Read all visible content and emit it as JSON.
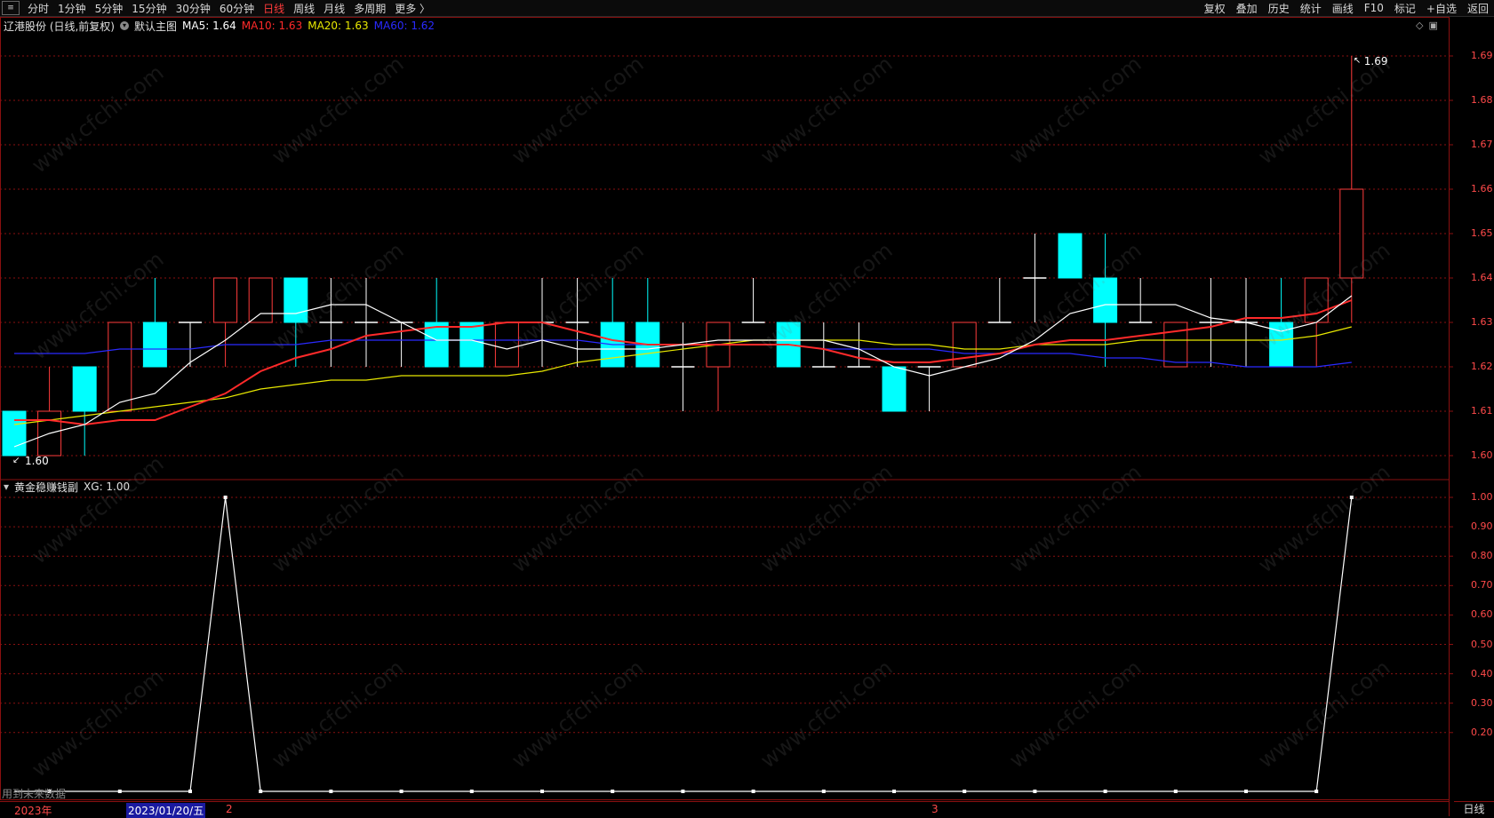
{
  "toolbar": {
    "menu_icon": "menu-icon",
    "periods": [
      {
        "label": "分时",
        "active": false
      },
      {
        "label": "1分钟",
        "active": false
      },
      {
        "label": "5分钟",
        "active": false
      },
      {
        "label": "15分钟",
        "active": false
      },
      {
        "label": "30分钟",
        "active": false
      },
      {
        "label": "60分钟",
        "active": false
      },
      {
        "label": "日线",
        "active": true
      },
      {
        "label": "周线",
        "active": false
      },
      {
        "label": "月线",
        "active": false
      },
      {
        "label": "多周期",
        "active": false
      },
      {
        "label": "更多 〉",
        "active": false
      }
    ],
    "right": [
      "复权",
      "叠加",
      "历史",
      "统计",
      "画线",
      "F10",
      "标记",
      "+自选",
      "返回"
    ]
  },
  "main_legend": {
    "title": "辽港股份 (日线,前复权)",
    "template": "默认主图",
    "ma5": "MA5: 1.64",
    "ma10": "MA10: 1.63",
    "ma20": "MA20: 1.63",
    "ma60": "MA60: 1.62"
  },
  "sub_legend": {
    "title": "黄金稳赚钱副",
    "value": "XG: 1.00"
  },
  "colors": {
    "up": "#ff3b3b",
    "down": "#00ffff",
    "ma5": "#ffffff",
    "ma10": "#ff2a2a",
    "ma20": "#e8e800",
    "ma60": "#2a2aff",
    "grid": "#8a1010",
    "axis": "#ff4a4a"
  },
  "annotations": {
    "max_label": "1.69",
    "min_label": "1.60"
  },
  "main_axis_labels": [
    "1.69",
    "1.68",
    "1.67",
    "1.66",
    "1.65",
    "1.64",
    "1.63",
    "1.62",
    "1.61",
    "1.60"
  ],
  "sub_axis_labels": [
    "1.00",
    "0.90",
    "0.80",
    "0.70",
    "0.60",
    "0.50",
    "0.40",
    "0.30",
    "0.20"
  ],
  "date_axis": {
    "year": "2023年",
    "cursor_date": "2023/01/20/五",
    "month2": "2",
    "month3": "3"
  },
  "period_tab": "日线",
  "footer_note": "用到未来数据",
  "watermark": "www.cfchi.com",
  "chart_data": {
    "type": "candlestick",
    "ylim": [
      1.595,
      1.695
    ],
    "candles": [
      {
        "o": 1.61,
        "h": 1.61,
        "l": 1.6,
        "c": 1.6
      },
      {
        "o": 1.6,
        "h": 1.62,
        "l": 1.6,
        "c": 1.61
      },
      {
        "o": 1.62,
        "h": 1.62,
        "l": 1.6,
        "c": 1.61
      },
      {
        "o": 1.61,
        "h": 1.63,
        "l": 1.61,
        "c": 1.63
      },
      {
        "o": 1.63,
        "h": 1.64,
        "l": 1.62,
        "c": 1.62
      },
      {
        "o": 1.63,
        "h": 1.63,
        "l": 1.62,
        "c": 1.63
      },
      {
        "o": 1.63,
        "h": 1.64,
        "l": 1.62,
        "c": 1.64
      },
      {
        "o": 1.63,
        "h": 1.64,
        "l": 1.63,
        "c": 1.64
      },
      {
        "o": 1.64,
        "h": 1.64,
        "l": 1.62,
        "c": 1.63
      },
      {
        "o": 1.63,
        "h": 1.64,
        "l": 1.62,
        "c": 1.63
      },
      {
        "o": 1.63,
        "h": 1.64,
        "l": 1.62,
        "c": 1.63
      },
      {
        "o": 1.63,
        "h": 1.63,
        "l": 1.62,
        "c": 1.63
      },
      {
        "o": 1.63,
        "h": 1.64,
        "l": 1.62,
        "c": 1.62
      },
      {
        "o": 1.63,
        "h": 1.63,
        "l": 1.62,
        "c": 1.62
      },
      {
        "o": 1.62,
        "h": 1.63,
        "l": 1.62,
        "c": 1.63
      },
      {
        "o": 1.63,
        "h": 1.64,
        "l": 1.62,
        "c": 1.63
      },
      {
        "o": 1.63,
        "h": 1.64,
        "l": 1.62,
        "c": 1.63
      },
      {
        "o": 1.63,
        "h": 1.64,
        "l": 1.62,
        "c": 1.62
      },
      {
        "o": 1.63,
        "h": 1.64,
        "l": 1.62,
        "c": 1.62
      },
      {
        "o": 1.62,
        "h": 1.63,
        "l": 1.61,
        "c": 1.62
      },
      {
        "o": 1.62,
        "h": 1.63,
        "l": 1.61,
        "c": 1.63
      },
      {
        "o": 1.63,
        "h": 1.64,
        "l": 1.63,
        "c": 1.63
      },
      {
        "o": 1.63,
        "h": 1.63,
        "l": 1.62,
        "c": 1.62
      },
      {
        "o": 1.62,
        "h": 1.63,
        "l": 1.62,
        "c": 1.62
      },
      {
        "o": 1.62,
        "h": 1.63,
        "l": 1.62,
        "c": 1.62
      },
      {
        "o": 1.62,
        "h": 1.62,
        "l": 1.61,
        "c": 1.61
      },
      {
        "o": 1.62,
        "h": 1.62,
        "l": 1.61,
        "c": 1.62
      },
      {
        "o": 1.62,
        "h": 1.63,
        "l": 1.62,
        "c": 1.63
      },
      {
        "o": 1.63,
        "h": 1.64,
        "l": 1.63,
        "c": 1.63
      },
      {
        "o": 1.64,
        "h": 1.65,
        "l": 1.63,
        "c": 1.64
      },
      {
        "o": 1.65,
        "h": 1.65,
        "l": 1.64,
        "c": 1.64
      },
      {
        "o": 1.64,
        "h": 1.65,
        "l": 1.62,
        "c": 1.63
      },
      {
        "o": 1.63,
        "h": 1.64,
        "l": 1.63,
        "c": 1.63
      },
      {
        "o": 1.62,
        "h": 1.63,
        "l": 1.62,
        "c": 1.63
      },
      {
        "o": 1.63,
        "h": 1.64,
        "l": 1.62,
        "c": 1.63
      },
      {
        "o": 1.63,
        "h": 1.64,
        "l": 1.62,
        "c": 1.63
      },
      {
        "o": 1.63,
        "h": 1.64,
        "l": 1.62,
        "c": 1.62
      },
      {
        "o": 1.63,
        "h": 1.64,
        "l": 1.62,
        "c": 1.64
      },
      {
        "o": 1.64,
        "h": 1.69,
        "l": 1.63,
        "c": 1.66
      }
    ],
    "ma5": [
      1.602,
      1.605,
      1.607,
      1.612,
      1.614,
      1.621,
      1.626,
      1.632,
      1.632,
      1.634,
      1.634,
      1.63,
      1.626,
      1.626,
      1.624,
      1.626,
      1.624,
      1.624,
      1.624,
      1.625,
      1.626,
      1.626,
      1.626,
      1.626,
      1.624,
      1.62,
      1.618,
      1.62,
      1.622,
      1.626,
      1.632,
      1.634,
      1.634,
      1.634,
      1.631,
      1.63,
      1.628,
      1.63,
      1.636
    ],
    "ma10": [
      1.608,
      1.608,
      1.607,
      1.608,
      1.608,
      1.611,
      1.614,
      1.619,
      1.622,
      1.624,
      1.627,
      1.628,
      1.629,
      1.629,
      1.63,
      1.63,
      1.628,
      1.626,
      1.625,
      1.625,
      1.625,
      1.625,
      1.625,
      1.624,
      1.622,
      1.621,
      1.621,
      1.622,
      1.623,
      1.625,
      1.626,
      1.626,
      1.627,
      1.628,
      1.629,
      1.631,
      1.631,
      1.632,
      1.635
    ],
    "ma20": [
      1.607,
      1.608,
      1.609,
      1.61,
      1.611,
      1.612,
      1.613,
      1.615,
      1.616,
      1.617,
      1.617,
      1.618,
      1.618,
      1.618,
      1.618,
      1.619,
      1.621,
      1.622,
      1.623,
      1.624,
      1.625,
      1.626,
      1.626,
      1.626,
      1.626,
      1.625,
      1.625,
      1.624,
      1.624,
      1.625,
      1.625,
      1.625,
      1.626,
      1.626,
      1.626,
      1.626,
      1.626,
      1.627,
      1.629
    ],
    "ma60": [
      1.623,
      1.623,
      1.623,
      1.624,
      1.624,
      1.624,
      1.625,
      1.625,
      1.625,
      1.626,
      1.626,
      1.626,
      1.626,
      1.626,
      1.626,
      1.626,
      1.626,
      1.625,
      1.625,
      1.625,
      1.625,
      1.625,
      1.625,
      1.624,
      1.624,
      1.624,
      1.624,
      1.623,
      1.623,
      1.623,
      1.623,
      1.622,
      1.622,
      1.621,
      1.621,
      1.62,
      1.62,
      1.62,
      1.621
    ],
    "xg_series": {
      "name": "XG",
      "ylim": [
        0,
        1.0
      ],
      "values": [
        0,
        0,
        0,
        0,
        0,
        0,
        1,
        0,
        0,
        0,
        0,
        0,
        0,
        0,
        0,
        0,
        0,
        0,
        0,
        0,
        0,
        0,
        0,
        0,
        0,
        0,
        0,
        0,
        0,
        0,
        0,
        0,
        0,
        0,
        0,
        0,
        0,
        0,
        1
      ]
    }
  }
}
